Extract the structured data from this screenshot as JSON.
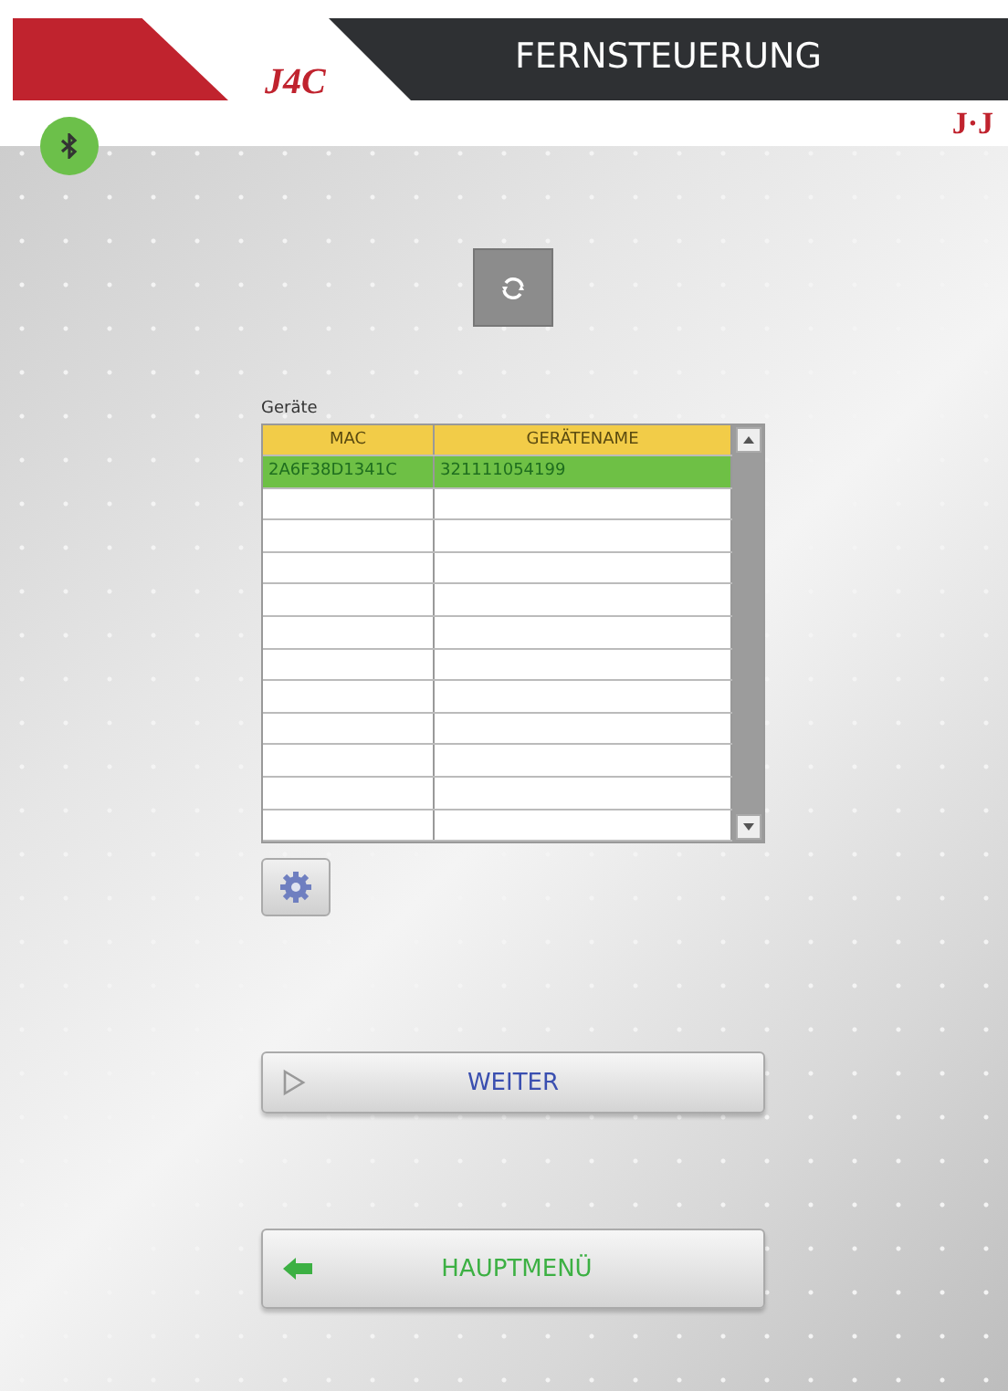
{
  "header": {
    "logo": "J4C",
    "title": "FERNSTEUERUNG",
    "brand": "J·J"
  },
  "bluetooth": {
    "connected": true
  },
  "devices": {
    "label": "Geräte",
    "columns": [
      "MAC",
      "GERÄTENAME"
    ],
    "rows": [
      {
        "cells": [
          "2A6F38D1341C",
          "321111054199"
        ],
        "selected": true
      }
    ]
  },
  "buttons": [
    {
      "kind": "next",
      "label": "WEITER"
    },
    {
      "kind": "menu",
      "label": "HAUPTMENÜ"
    }
  ]
}
